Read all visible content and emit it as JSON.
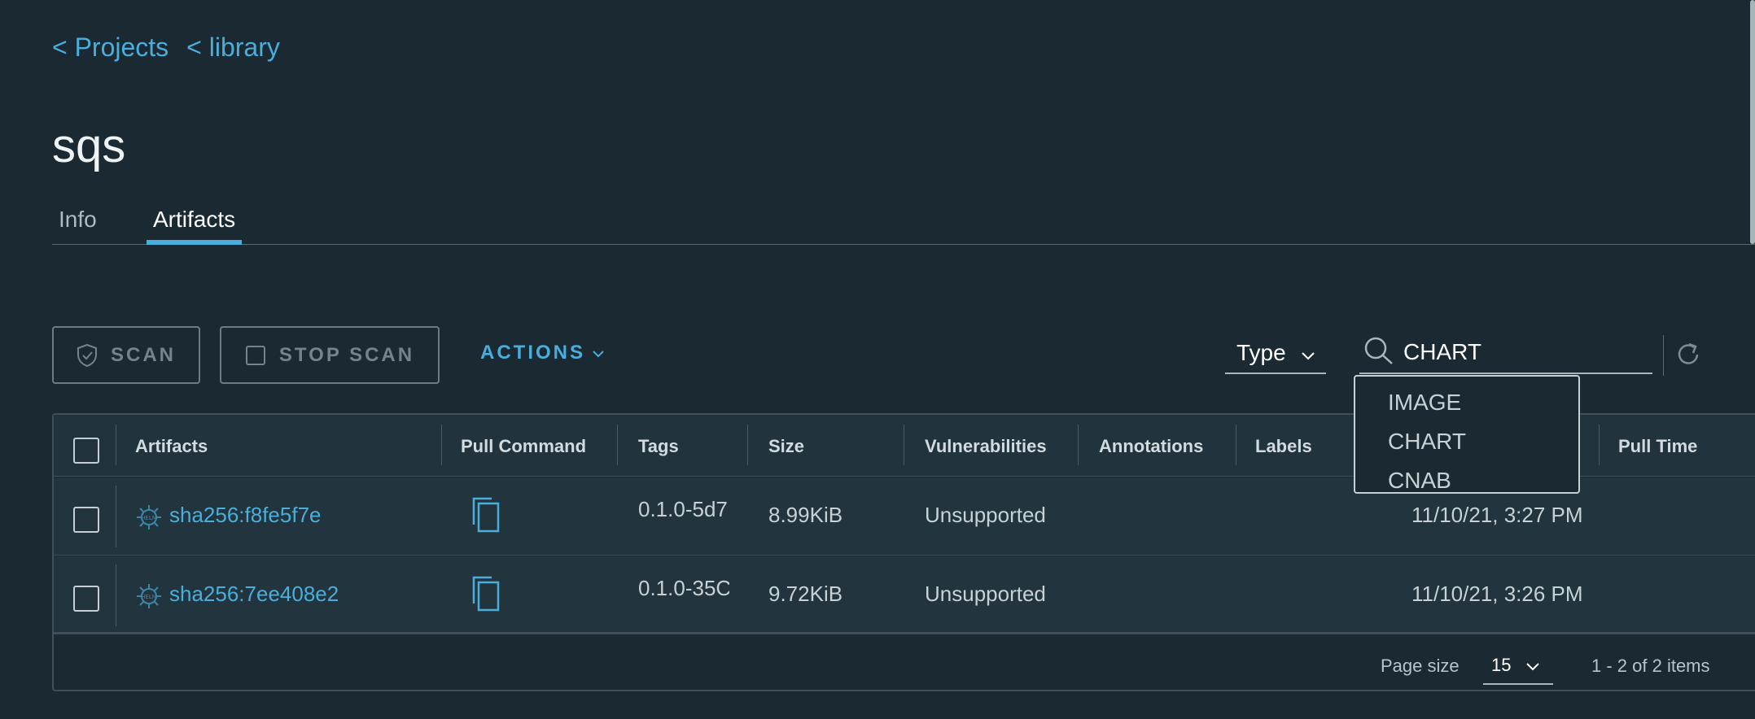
{
  "breadcrumb": [
    "< Projects",
    "< library"
  ],
  "repository_title": "sqs",
  "tabs": {
    "info": "Info",
    "artifacts": "Artifacts",
    "active": "Artifacts"
  },
  "toolbar": {
    "scan_label": "SCAN",
    "stop_scan_label": "STOP SCAN",
    "actions_label": "ACTIONS",
    "filter_type_label": "Type",
    "search_value": "CHART"
  },
  "type_dropdown": {
    "options": [
      "IMAGE",
      "CHART",
      "CNAB"
    ]
  },
  "table": {
    "columns": [
      "Artifacts",
      "Pull Command",
      "Tags",
      "Size",
      "Vulnerabilities",
      "Annotations",
      "Labels",
      "Pull Time"
    ],
    "rows": [
      {
        "artifact": "sha256:f8fe5f7e",
        "tags": "0.1.0-5d7",
        "size": "8.99KiB",
        "vulnerabilities": "Unsupported",
        "push_time": "11/10/21, 3:27 PM"
      },
      {
        "artifact": "sha256:7ee408e2",
        "tags": "0.1.0-35C",
        "size": "9.72KiB",
        "vulnerabilities": "Unsupported",
        "push_time": "11/10/21, 3:26 PM"
      }
    ]
  },
  "pagination": {
    "page_size_label": "Page size",
    "page_size": "15",
    "summary": "1 - 2 of 2 items"
  },
  "colors": {
    "background": "#1b2a32",
    "accent": "#49aedb",
    "row": "#22343d"
  }
}
